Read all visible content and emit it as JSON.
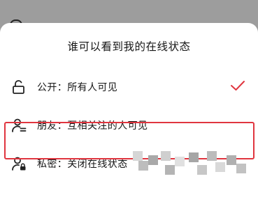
{
  "sheet": {
    "title": "谁可以看到我的在线状态",
    "options": [
      {
        "label": "公开：所有人可见",
        "icon": "unlock-icon",
        "selected": true
      },
      {
        "label": "朋友：互相关注的人可见",
        "icon": "mutual-friends-icon",
        "selected": false
      },
      {
        "label": "私密：关闭在线状态",
        "icon": "private-user-lock-icon",
        "selected": false
      }
    ]
  },
  "colors": {
    "accent": "#e0353f",
    "text": "#161616",
    "backdrop": "#9d9d9d"
  }
}
